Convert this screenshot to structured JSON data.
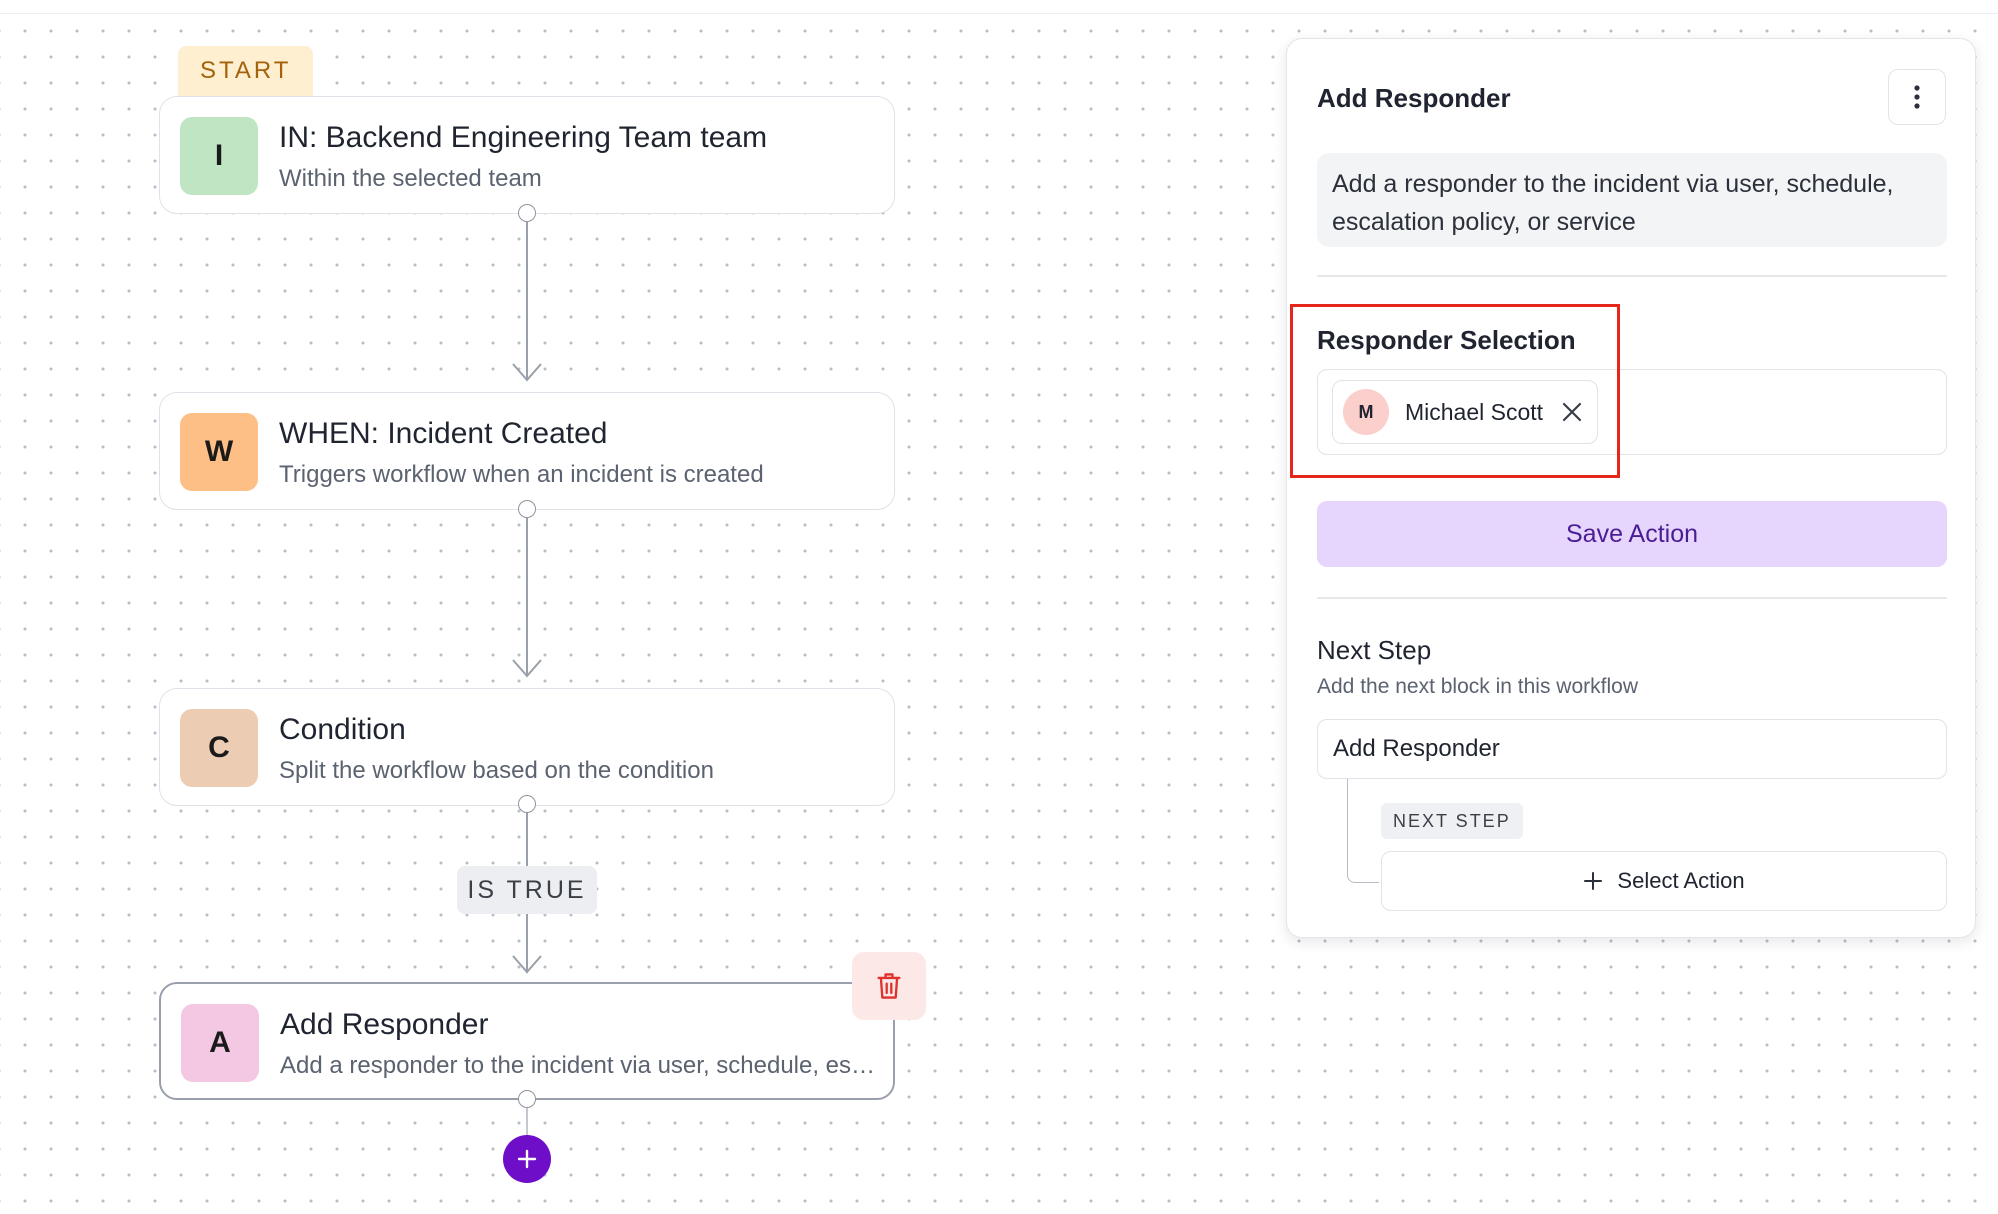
{
  "workflow": {
    "start_label": "START",
    "nodes": [
      {
        "letter": "I",
        "title": "IN: Backend Engineering Team team",
        "subtitle": "Within the selected team",
        "color": "#bfe5c3"
      },
      {
        "letter": "W",
        "title": "WHEN: Incident Created",
        "subtitle": "Triggers workflow when an incident is created",
        "color": "#fdbf85"
      },
      {
        "letter": "C",
        "title": "Condition",
        "subtitle": "Split the workflow based on the condition",
        "color": "#ecccb2"
      },
      {
        "letter": "A",
        "title": "Add Responder",
        "subtitle": "Add a responder to the incident via user, schedule, escalation policy, or service",
        "color": "#f4c8e2"
      }
    ],
    "condition_label": "IS TRUE"
  },
  "panel": {
    "title": "Add Responder",
    "description": "Add a responder to the incident via user, schedule, escalation policy, or service",
    "responder_selection_label": "Responder Selection",
    "selected_responder": {
      "initial": "M",
      "name": "Michael Scott"
    },
    "save_label": "Save Action",
    "next_step_title": "Next Step",
    "next_step_subtitle": "Add the next block in this workflow",
    "next_block_name": "Add Responder",
    "next_step_badge": "NEXT STEP",
    "select_action_label": "Select Action"
  },
  "colors": {
    "accent_purple": "#6f0ec9",
    "save_button_bg": "#e6d6fd",
    "highlight_red": "#e5271b",
    "trash_red": "#e0312b"
  },
  "icons": [
    "kebab-menu-icon",
    "close-icon",
    "trash-icon",
    "plus-icon"
  ]
}
